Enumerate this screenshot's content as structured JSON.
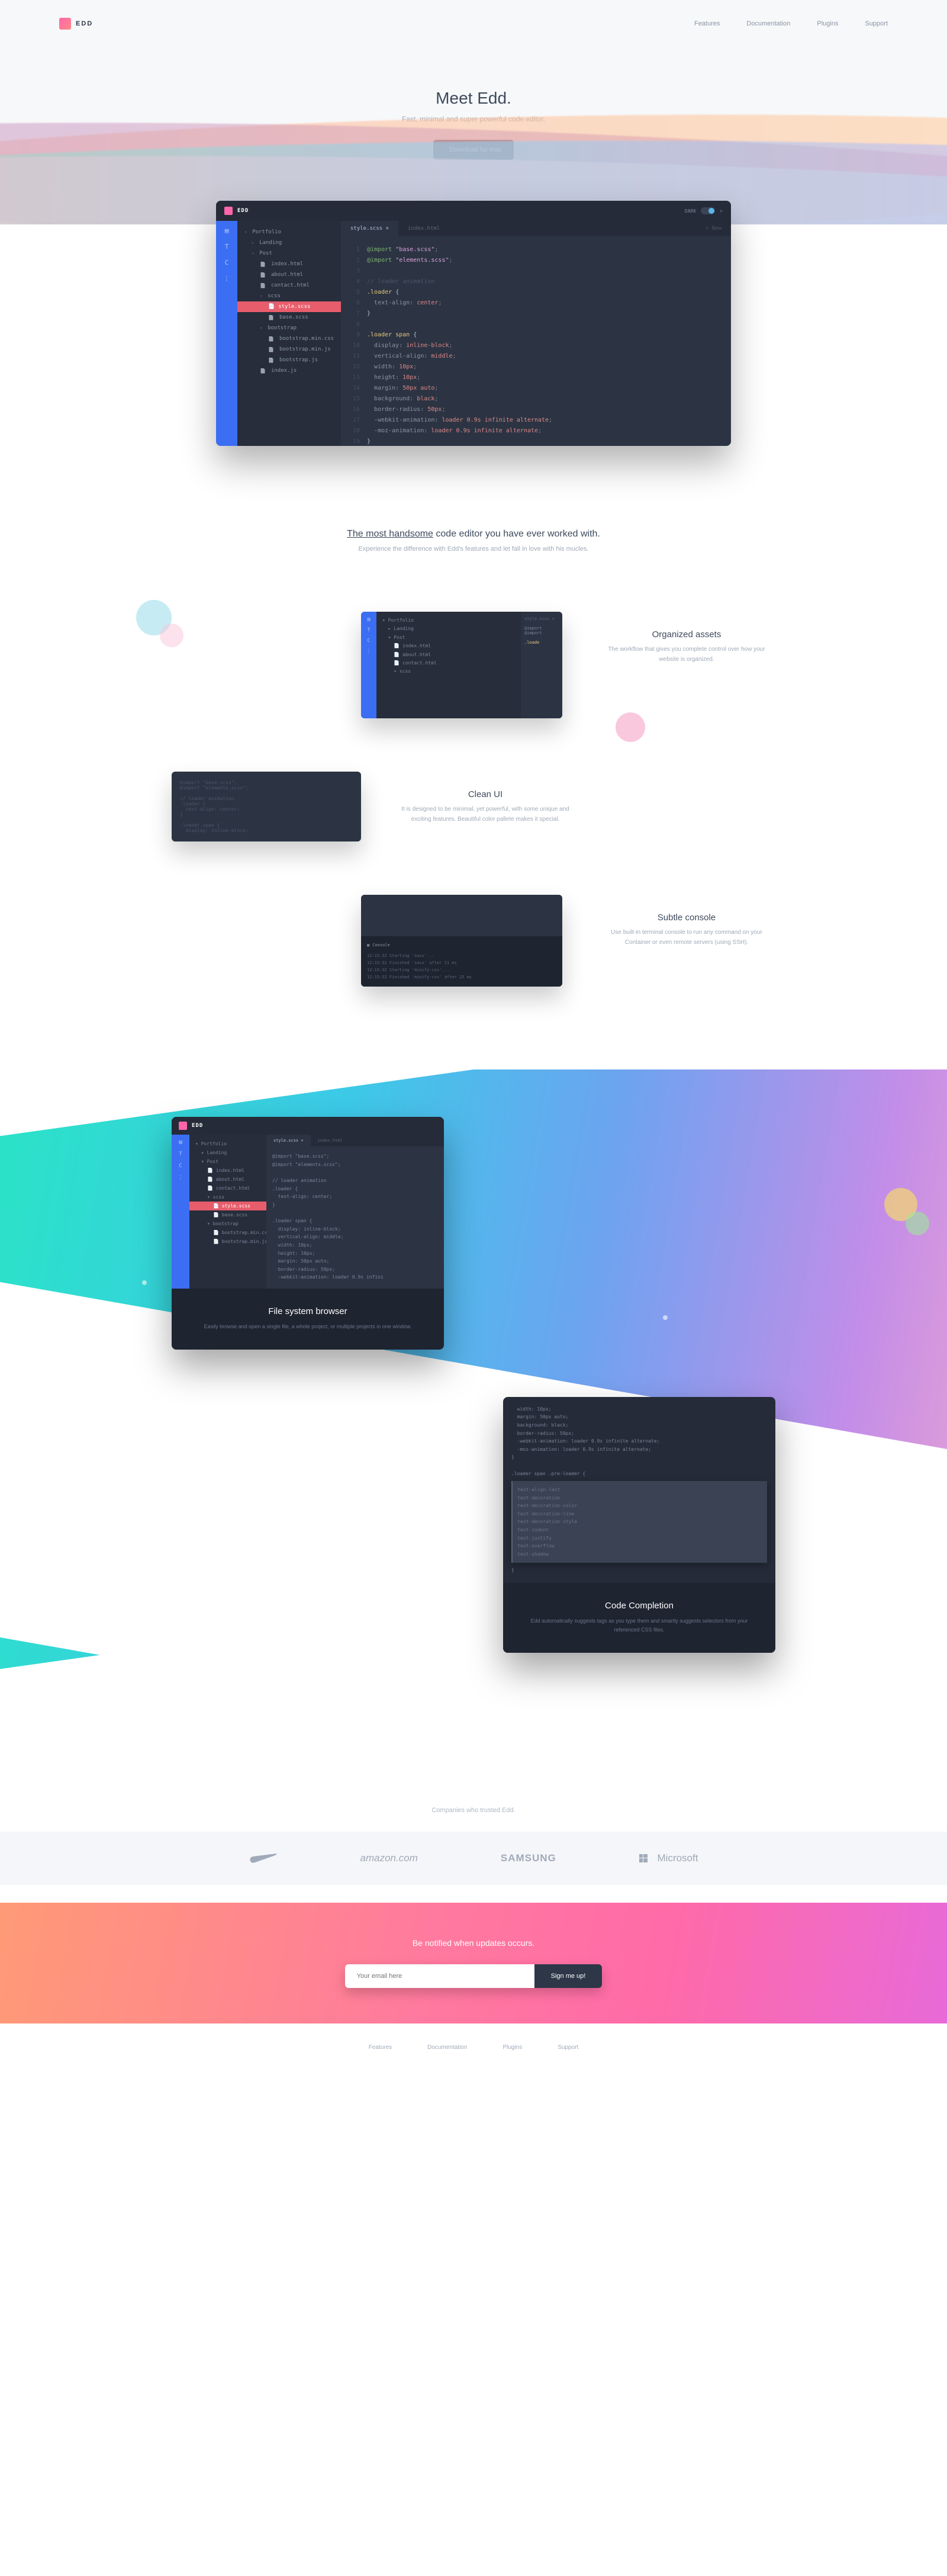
{
  "brand": "EDD",
  "nav": {
    "features": "Features",
    "docs": "Documentation",
    "plugins": "Plugins",
    "support": "Support"
  },
  "hero": {
    "title": "Meet Edd.",
    "sub": "Fast, minimal and super powerful code editor.",
    "cta": "Download for mac"
  },
  "editor": {
    "brand": "EDD",
    "dark": "DARK",
    "tree": {
      "root": "Portfolio",
      "landing": "Landing",
      "post": "Post",
      "index": "index.html",
      "about": "about.html",
      "contact": "contact.html",
      "scss": "scss",
      "style": "style.scss",
      "base": "base.scss",
      "bootstrap": "bootstrap",
      "bcss": "bootstrap.min.css",
      "bminjs": "bootstrap.min.js",
      "bjs": "bootstrap.js",
      "indexjs": "index.js"
    },
    "tabs": {
      "t1": "style.scss ×",
      "t2": "index.html",
      "new": "+ New"
    },
    "code": {
      "l1a": "@import",
      "l1b": "\"base.scss\"",
      "l2a": "@import",
      "l2b": "\"elements.scss\"",
      "l4c": "// loader animation",
      "l5": ".loader",
      "l6p": "text-align:",
      "l6v": "center",
      "l9": ".loader span",
      "l10p": "display:",
      "l10v": "inline-block",
      "l11p": "vertical-align:",
      "l11v": "middle",
      "l12p": "width:",
      "l12v": "10px",
      "l13p": "height:",
      "l13v": "10px",
      "l14p": "margin:",
      "l14v": "50px auto",
      "l15p": "background:",
      "l15v": "black",
      "l16p": "border-radius:",
      "l16v": "50px",
      "l17p": "-webkit-animation:",
      "l17v": "loader 0.9s infinite alternate",
      "l18p": "-moz-animation:",
      "l18v": "loader 0.9s infinite alternate"
    }
  },
  "handsome": {
    "h_u": "The most handsome",
    "h_r": " code editor you have ever worked with.",
    "p": "Experience the difference with Edd's features and let fall in love with his mucles."
  },
  "features": {
    "organized": {
      "title": "Organized assets",
      "desc": "The workflow that gives you complete control over how your website is organized.",
      "tab": "style.scss ×"
    },
    "clean": {
      "title": "Clean UI",
      "desc": "It is designed to be minimal, yet powerful, with some unique and exciting features. Beautiful color pallete makes it special."
    },
    "console": {
      "title": "Subtle console",
      "desc": "Use built-in terminal console to run any command on your Container or even remote servers (using SSH).",
      "label": "Console",
      "l1": "12:15:32 Starting 'sass'...",
      "l2": "12:15:32 Finished 'sass' after 21 ms",
      "l3": "12:15:32 Starting 'minify-css'...",
      "l4": "12:15:32 Finished 'minify-css' after 25 ms"
    }
  },
  "big": {
    "fs": {
      "title": "File system browser",
      "desc": "Easily browse and open a single file, a whole project, or multiple projects in one window."
    },
    "cc": {
      "title": "Code Completion",
      "desc": "Edd automatically suggests tags as you type them and smartly suggests selectors from your referenced CSS files.",
      "trigger": ".loader span .pre-loader",
      "opts": [
        "text-align-last",
        "text-decoration",
        "text-decoration-color",
        "text-decoration-line",
        "text-decoration-style",
        "text-indent",
        "text-justify",
        "text-overflow",
        "text-shadow"
      ]
    }
  },
  "companies": {
    "label": "Companies who trusted Edd.",
    "c1": "amazon.com",
    "c2": "SAMSUNG",
    "c3": "Microsoft"
  },
  "signup": {
    "label": "Be notified when updates occurs.",
    "placeholder": "Your email here",
    "cta": "Sign me up!"
  },
  "footer": {
    "features": "Features",
    "docs": "Documentation",
    "plugins": "Plugins",
    "support": "Support"
  }
}
